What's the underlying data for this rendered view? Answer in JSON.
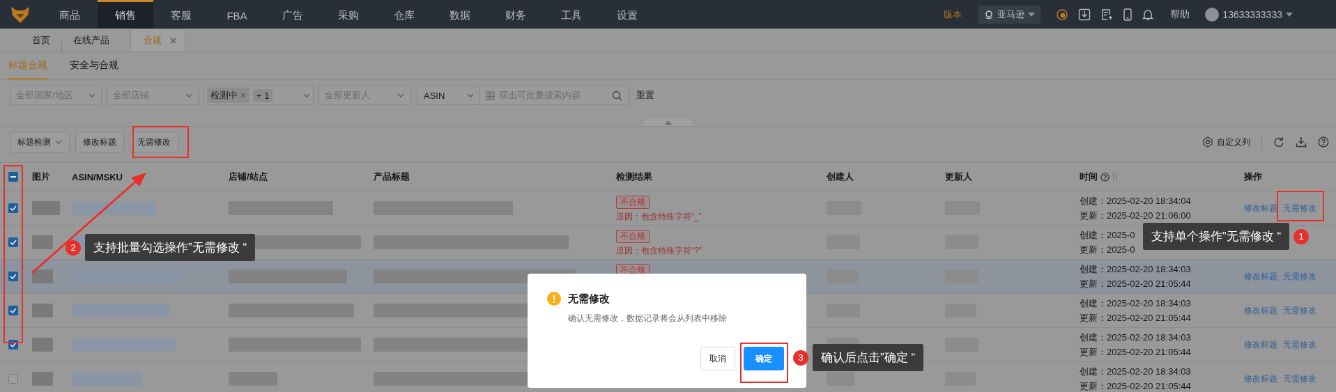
{
  "nav": {
    "items": [
      {
        "label": "商品",
        "selected": false
      },
      {
        "label": "销售",
        "selected": true
      },
      {
        "label": "客服",
        "selected": false
      },
      {
        "label": "FBA",
        "selected": false
      },
      {
        "label": "广告",
        "selected": false
      },
      {
        "label": "采购",
        "selected": false
      },
      {
        "label": "仓库",
        "selected": false
      },
      {
        "label": "数据",
        "selected": false
      },
      {
        "label": "财务",
        "selected": false
      },
      {
        "label": "工具",
        "selected": false
      },
      {
        "label": "设置",
        "selected": false
      }
    ],
    "version": "版本",
    "platform": "亚马逊",
    "help": "帮助",
    "user": "13633333333"
  },
  "page_tabs": [
    {
      "label": "首页",
      "selected": false,
      "closable": false
    },
    {
      "label": "在线产品",
      "selected": false,
      "closable": false
    },
    {
      "label": "合规",
      "selected": true,
      "closable": true
    }
  ],
  "sub_tabs": [
    {
      "label": "标题合规",
      "selected": true
    },
    {
      "label": "安全与合规",
      "selected": false
    }
  ],
  "filters": [
    {
      "kind": "select",
      "placeholder": "全部国家/地区"
    },
    {
      "kind": "select",
      "placeholder": "全部店铺"
    },
    {
      "kind": "tags",
      "tags": [
        {
          "label": "检测中",
          "removable": true
        },
        {
          "label": "+ 1",
          "removable": false
        }
      ]
    },
    {
      "kind": "select",
      "placeholder": "全部更新人"
    },
    {
      "kind": "field",
      "value": "ASIN"
    },
    {
      "kind": "search",
      "placeholder": "双击可批量搜索内容"
    },
    {
      "kind": "link",
      "label": "重置"
    }
  ],
  "toolbar": {
    "buttons": [
      {
        "label": "标题检测",
        "dropdown": true
      },
      {
        "label": "修改标题",
        "dropdown": false
      },
      {
        "label": "无需修改",
        "dropdown": false
      }
    ],
    "column_settings": "自定义列"
  },
  "table": {
    "select_all": {
      "indeterminate": true
    },
    "columns": [
      {
        "label": "图片",
        "help": false,
        "sortable": false
      },
      {
        "label": "ASIN/MSKU",
        "help": false,
        "sortable": false
      },
      {
        "label": "店铺/站点",
        "help": false,
        "sortable": false
      },
      {
        "label": "产品标题",
        "help": false,
        "sortable": false
      },
      {
        "label": "检测结果",
        "help": false,
        "sortable": false
      },
      {
        "label": "创建人",
        "help": false,
        "sortable": false
      },
      {
        "label": "更新人",
        "help": false,
        "sortable": false
      },
      {
        "label": "时间",
        "help": true,
        "sortable": true
      },
      {
        "label": "操作",
        "help": false,
        "sortable": false
      }
    ],
    "rows": [
      {
        "checked": true,
        "highlighted": false,
        "result": "不合规",
        "reason": "原因：包含特殊字符“_”",
        "created": "创建：2025-02-20 18:34:04",
        "updated": "更新：2025-02-20 21:06:00",
        "actions": [
          "修改标题",
          "无需修改"
        ]
      },
      {
        "checked": true,
        "highlighted": false,
        "result": "不合规",
        "reason": "原因：包含特殊字符“?”",
        "created": "创建：2025-0",
        "updated": "更新：2025-0"
      },
      {
        "checked": true,
        "highlighted": true,
        "result": "不合规",
        "created": "创建：2025-02-20 18:34:03",
        "updated": "更新：2025-02-20 21:05:44",
        "actions": [
          "修改标题",
          "无需修改"
        ]
      },
      {
        "checked": true,
        "highlighted": false,
        "created": "创建：2025-02-20 18:34:03",
        "updated": "更新：2025-02-20 21:05:44",
        "actions": [
          "修改标题",
          "无需修改"
        ]
      },
      {
        "checked": true,
        "highlighted": false,
        "created": "创建：2025-02-20 18:34:03",
        "updated": "更新：2025-02-20 21:05:44",
        "actions": [
          "修改标题",
          "无需修改"
        ]
      },
      {
        "checked": false,
        "highlighted": false,
        "created": "创建：2025-02-20 18:34:03",
        "updated": "更新：2025-02-20 21:05:44",
        "actions": [
          "修改标题",
          "无需修改"
        ]
      }
    ]
  },
  "dialog": {
    "title": "无需修改",
    "message": "确认无需修改，数据记录将会从列表中移除",
    "buttons": [
      {
        "label": "取消",
        "primary": false
      },
      {
        "label": "确定",
        "primary": true
      }
    ]
  },
  "annotations": [
    {
      "number": "1",
      "text": "支持单个操作”无需修改 “"
    },
    {
      "number": "2",
      "text": "支持批量勾选操作”无需修改 “"
    },
    {
      "number": "3",
      "text": "确认后点击”确定 “"
    }
  ]
}
